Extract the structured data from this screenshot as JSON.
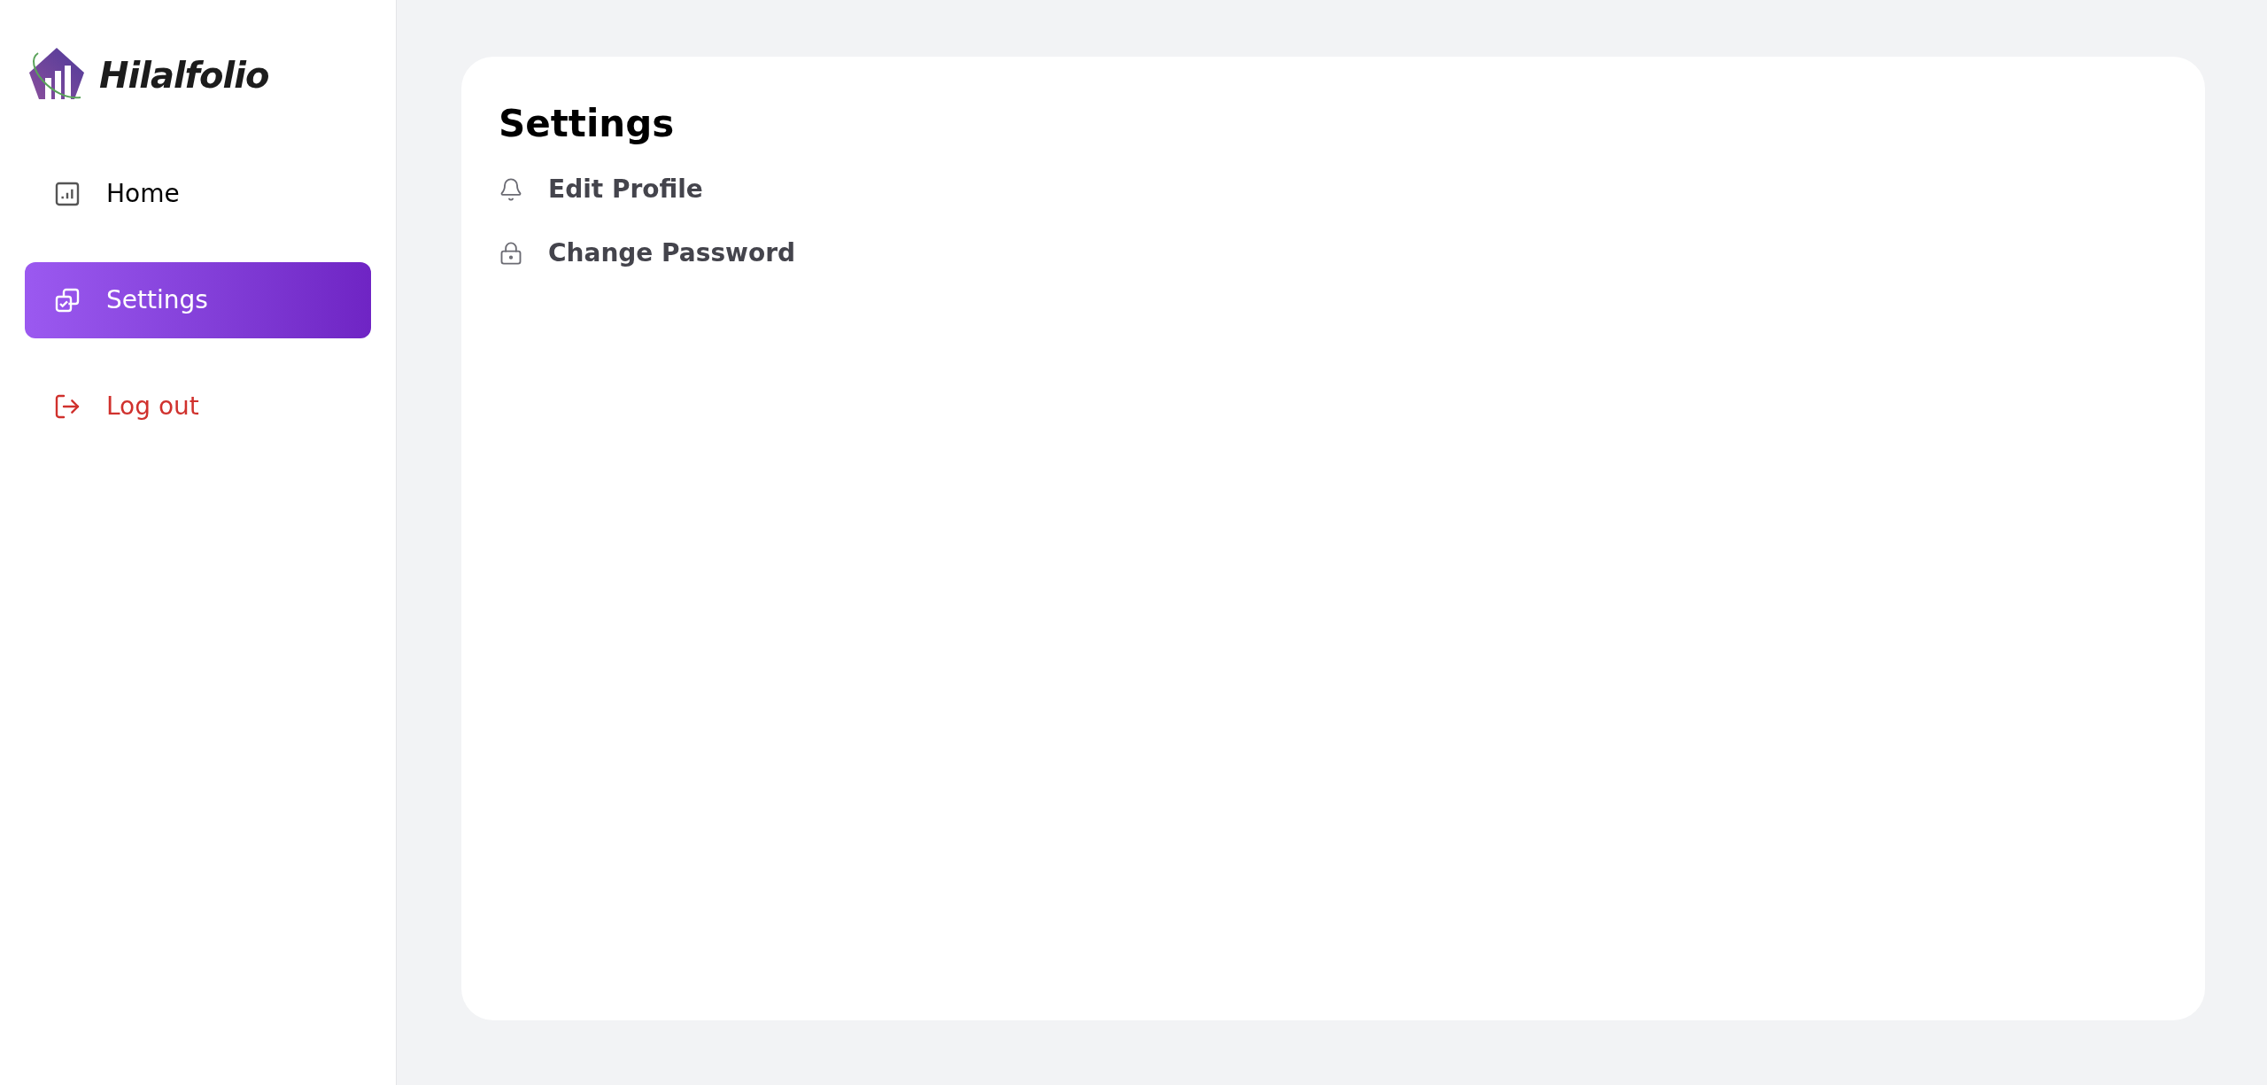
{
  "sidebar": {
    "brand": "Hilalfolio",
    "items": [
      {
        "kind": "home",
        "label": "Home",
        "selected": false
      },
      {
        "kind": "settings",
        "label": "Settings",
        "selected": true
      },
      {
        "kind": "logout",
        "label": "Log out",
        "selected": false
      }
    ]
  },
  "main": {
    "title": "Settings",
    "items": [
      {
        "kind": "profile",
        "label": "Edit Profile"
      },
      {
        "kind": "password",
        "label": "Change Password"
      }
    ]
  }
}
